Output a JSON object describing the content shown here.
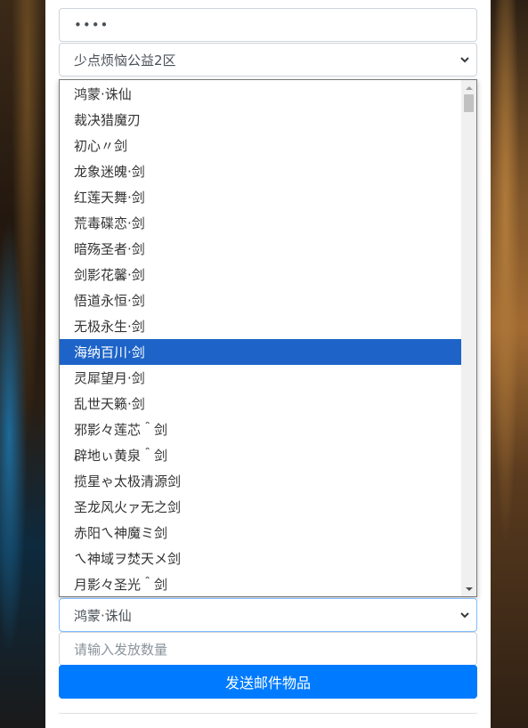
{
  "password_field": {
    "value": "••••"
  },
  "server_select": {
    "selected": "少点烦恼公益2区"
  },
  "item_dropdown": {
    "options": [
      "鸿蒙·诛仙",
      "裁决猎魔刃",
      "初心〃剑",
      "龙象迷魄·剑",
      "红莲天舞·剑",
      "荒毒碟恋·剑",
      "暗殇圣者·剑",
      "剑影花馨·剑",
      "悟道永恒·剑",
      "无极永生·剑",
      "海纳百川·剑",
      "灵犀望月·剑",
      "乱世天籁·剑",
      "邪影々莲芯＾剑",
      "辟地ぃ黄泉＾剑",
      "揽星ゃ太极清源剑",
      "圣龙风火ァ无之剑",
      "赤阳ㄟ神魔ミ剑",
      "ㄟ神域ヲ焚天メ剑",
      "月影々圣光＾剑"
    ],
    "highlighted_index": 10
  },
  "item_select": {
    "selected": "鸿蒙·诛仙"
  },
  "quantity_field": {
    "placeholder": "请输入发放数量"
  },
  "send_button": {
    "label": "发送邮件物品"
  },
  "colors": {
    "primary": "#007bff",
    "highlight": "#1e64c8",
    "border": "#ced4da"
  }
}
